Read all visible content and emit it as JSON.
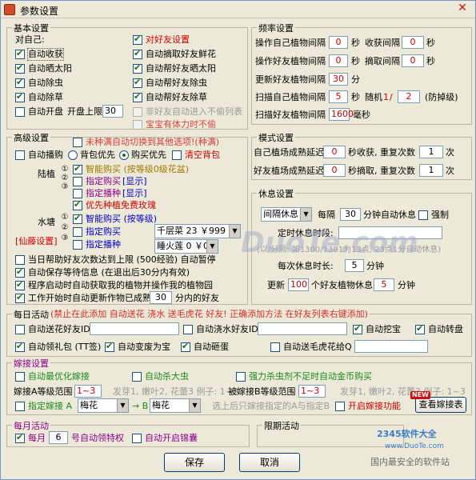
{
  "window": {
    "title": "参数设置"
  },
  "basic": {
    "title": "基本设置",
    "self": "对自己:",
    "auto_harvest": "自动收获",
    "auto_sun": "自动晒太阳",
    "auto_weed": "自动除虫",
    "auto_grass": "自动除草",
    "auto_open": "自动开盘",
    "open_limit_label": "开盘上限",
    "open_limit_value": "30",
    "friend_title": "对好友设置",
    "steal_fresh": "自动摘取好友鲜花",
    "help_sun": "自动帮好友晒太阳",
    "help_weed": "自动帮好友除虫",
    "help_grass": "自动帮好友除草",
    "nonfriend_enter": "非好友自动进入不偷列表",
    "treasure_no_steal": "宝宝有体力时不偷"
  },
  "freq": {
    "title": "频率设置",
    "op_self_label": "操作自己植物间隔",
    "op_self_value": "0",
    "sec": "秒",
    "harvest_label": "收获间隔",
    "harvest_value": "0",
    "op_friend_label": "操作好友植物间隔",
    "op_friend_value": "0",
    "pick_label": "摘取间隔",
    "pick_value": "0",
    "update_label": "更新好友植物间隔",
    "update_value": "30",
    "minute": "分",
    "scan_self_label": "扫描自己植物间隔",
    "scan_self_value": "5",
    "random_label": "随机",
    "random_min": "1",
    "random_sep": "/",
    "random_max": "2",
    "anti_label": "(防掉级)",
    "scan_friend_label": "扫描好友植物间隔",
    "scan_friend_value": "1600",
    "ms": "毫秒"
  },
  "advanced": {
    "title": "高级设置",
    "warn": "未种满自动切换到其他选项!(种满)",
    "auto_seed": "自动播购",
    "pack_first": "背包优先",
    "buy_first": "购买优先",
    "clear_pack": "清空背包",
    "land_label": "陆植",
    "smart_buy": "智能购买 (按等级0级花盆)",
    "assign_buy": "指定购买",
    "show1": "[显示]",
    "assign_plant": "指定播种",
    "show2": "[显示]",
    "rose_first": "优先种植免费玫瑰",
    "water_label": "水塘",
    "smart_buy2": "智能购买 (按等级)",
    "assign_buy2": "指定购买",
    "plant_select": "千层菜 23 ￥999",
    "assign_plant2": "指定播种",
    "plant_select2": "睡火莲 0 ￥0",
    "fairy_set": "[仙藤设置]",
    "nums": [
      "①",
      "②",
      "③",
      "①",
      "②",
      "③"
    ],
    "limit_pause": "当日帮助好友次数达到上限 (500经验) 自动暂停",
    "save_wait": "自动保存等待信息 (在退出后30分内有效)",
    "auto_fetch": "程序启动时自动获取我的植物并操作我的植物园",
    "update_start": "工作开始时自动更新作物已成熟",
    "update_value": "30",
    "update_suffix": "分内的好友"
  },
  "mode": {
    "title": "模式设置",
    "self_delay_label": "自己植场成熟延迟",
    "self_delay_value": "0",
    "self_mid": "秒收获, 重复次数",
    "self_repeat": "1",
    "times": "次",
    "friend_delay_label": "好友植场成熟延迟",
    "friend_delay_value": "0",
    "friend_mid": "秒摘取, 重复次数",
    "friend_repeat": "1"
  },
  "rest": {
    "title": "休息设置",
    "mode_select": "间隔休息",
    "every_label": "每隔",
    "every_value": "30",
    "every_suffix": "分钟自动休息",
    "force": "强制",
    "timed_label": "定时休息时段:",
    "timed_value": "",
    "hint": "(以/分隔: 如1300/1301为13点, 23点1分自动休息)",
    "each_label": "每次休息时长:",
    "each_value": "5",
    "each_unit": "分钟",
    "refresh_label": "更新",
    "refresh_value": "100",
    "refresh_mid": "个好友植物休息",
    "refresh_time": "5",
    "refresh_unit": "分钟"
  },
  "daily": {
    "title": "每日活动",
    "note": "(禁止在此添加 自动送花 浇水 送毛虎花 好友! 正确添加方法 在好友列表右键添加)",
    "send_flower": "自动送花好友ID",
    "send_flower_id": "",
    "water_friend": "自动浇水好友ID",
    "water_friend_id": "",
    "auto_dig": "自动挖宝",
    "auto_turn": "自动转盘",
    "gift_bag": "自动领礼包 (TT签)",
    "change_treasure": "自动变废为宝",
    "pet_egg": "自动砸蛋",
    "send_maohu": "自动送毛虎花给Q",
    "send_maohu_q": ""
  },
  "graft": {
    "title": "嫁接设置",
    "auto_optimal": "自动最优化嫁接",
    "auto_kill": "自动杀大虫",
    "strong_kill": "强力杀虫剂不足时自动金币购买",
    "range_a_label": "嫁接A等级范围",
    "range_a_value": "1~3",
    "range_a_hint": "发芽1, 嫩叶2, 花蕾3 例子: 1~3",
    "range_b_label": "被嫁接B等级范围",
    "range_b_value": "1~3",
    "range_b_hint": "发芽1, 嫩叶2, 花蕾3 例子: 1~3",
    "assign_graft": "指定嫁接 A",
    "a_select": "梅花",
    "arrow": "→ B",
    "b_select": "梅花",
    "after_hint": "选上后只嫁接指定的A与指定B",
    "open_func": "开启嫁接功能",
    "view_btn": "查看嫁接表",
    "new_badge": "NEW"
  },
  "monthly": {
    "title": "每月活动",
    "per_month": "每月",
    "day_value": "6",
    "day_suffix": "号自动领特权",
    "auto_chest": "自动开启锦囊"
  },
  "limited": {
    "title": "限期活动"
  },
  "footer": {
    "save": "保存",
    "cancel": "取消"
  },
  "watermark": {
    "site": "DuoTe.com",
    "badge": "2345软件大全",
    "badge_url": "www.DuoTe.com",
    "slogan": "国内最安全的软件站"
  }
}
